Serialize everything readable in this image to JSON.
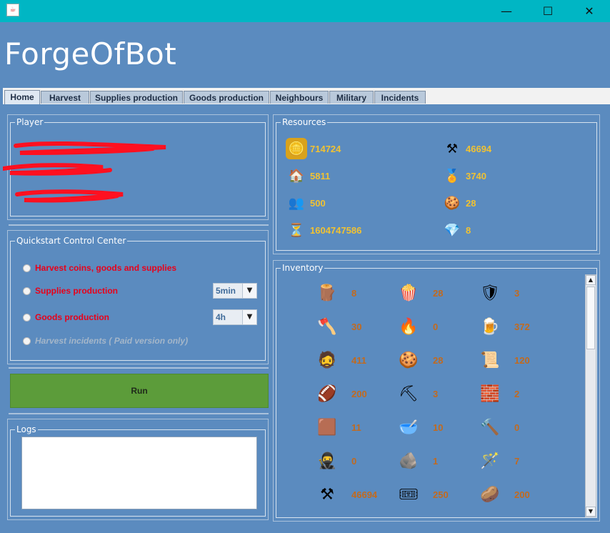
{
  "app": {
    "title": "ForgeOfBot"
  },
  "window": {
    "minimize": "—",
    "maximize": "☐",
    "close": "✕"
  },
  "tabs": [
    "Home",
    "Harvest",
    "Supplies production",
    "Goods production",
    "Neighbours",
    "Military",
    "Incidents"
  ],
  "player": {
    "legend": "Player"
  },
  "quickstart": {
    "legend": "Quickstart Control Center",
    "options": [
      {
        "label": "Harvest coins, goods and supplies"
      },
      {
        "label": "Supplies production",
        "select": "5min"
      },
      {
        "label": "Goods production",
        "select": "4h"
      },
      {
        "label": "Harvest incidents ( Paid version only)"
      }
    ]
  },
  "run_label": "Run",
  "logs": {
    "legend": "Logs"
  },
  "resources": {
    "legend": "Resources",
    "items": [
      {
        "icon": "coins-icon",
        "value": "714724"
      },
      {
        "icon": "hammer-icon",
        "value": "46694"
      },
      {
        "icon": "house-icon",
        "value": "5811"
      },
      {
        "icon": "medal-icon",
        "value": "3740"
      },
      {
        "icon": "people-icon",
        "value": "500"
      },
      {
        "icon": "cookies-icon",
        "value": "28"
      },
      {
        "icon": "hourglass-icon",
        "value": "1604747586"
      },
      {
        "icon": "diamond-icon",
        "value": "8"
      }
    ]
  },
  "inventory": {
    "legend": "Inventory",
    "items": [
      {
        "icon": "lumber-icon",
        "value": "8"
      },
      {
        "icon": "popcorn-icon",
        "value": "28"
      },
      {
        "icon": "shield-icon",
        "value": "3"
      },
      {
        "icon": "axe-icon",
        "value": "30"
      },
      {
        "icon": "torch-icon",
        "value": "0"
      },
      {
        "icon": "mug-icon",
        "value": "372"
      },
      {
        "icon": "viking-icon",
        "value": "411"
      },
      {
        "icon": "cookies-icon",
        "value": "28"
      },
      {
        "icon": "scroll-icon",
        "value": "120"
      },
      {
        "icon": "football-icon",
        "value": "200"
      },
      {
        "icon": "shovel-icon",
        "value": "3"
      },
      {
        "icon": "brick-icon",
        "value": "2"
      },
      {
        "icon": "plank-icon",
        "value": "11"
      },
      {
        "icon": "mortar-icon",
        "value": "10"
      },
      {
        "icon": "pickhammer-icon",
        "value": "0"
      },
      {
        "icon": "samurai-icon",
        "value": "0"
      },
      {
        "icon": "stone-icon",
        "value": "1"
      },
      {
        "icon": "staff-icon",
        "value": "7"
      },
      {
        "icon": "hammer-icon",
        "value": "46694"
      },
      {
        "icon": "ticket-icon",
        "value": "250"
      },
      {
        "icon": "rock-icon",
        "value": "200"
      }
    ]
  }
}
